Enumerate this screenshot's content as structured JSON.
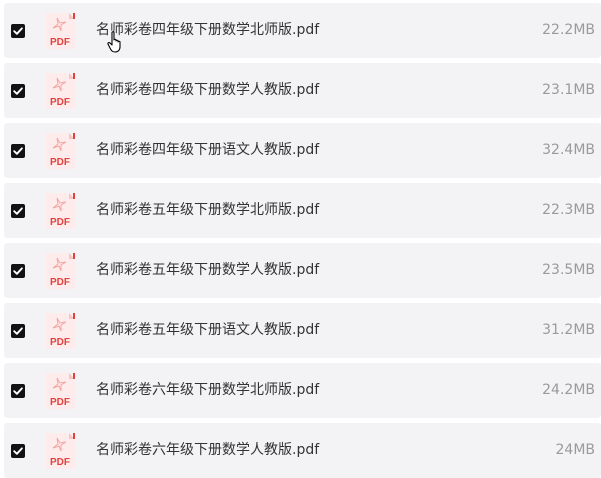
{
  "files": [
    {
      "name": "名师彩卷四年级下册数学北师版.pdf",
      "size": "22.2MB",
      "checked": true,
      "icon": "pdf-icon",
      "icon_label": "PDF"
    },
    {
      "name": "名师彩卷四年级下册数学人教版.pdf",
      "size": "23.1MB",
      "checked": true,
      "icon": "pdf-icon",
      "icon_label": "PDF"
    },
    {
      "name": "名师彩卷四年级下册语文人教版.pdf",
      "size": "32.4MB",
      "checked": true,
      "icon": "pdf-icon",
      "icon_label": "PDF"
    },
    {
      "name": "名师彩卷五年级下册数学北师版.pdf",
      "size": "22.3MB",
      "checked": true,
      "icon": "pdf-icon",
      "icon_label": "PDF"
    },
    {
      "name": "名师彩卷五年级下册数学人教版.pdf",
      "size": "23.5MB",
      "checked": true,
      "icon": "pdf-icon",
      "icon_label": "PDF"
    },
    {
      "name": "名师彩卷五年级下册语文人教版.pdf",
      "size": "31.2MB",
      "checked": true,
      "icon": "pdf-icon",
      "icon_label": "PDF"
    },
    {
      "name": "名师彩卷六年级下册数学北师版.pdf",
      "size": "24.2MB",
      "checked": true,
      "icon": "pdf-icon",
      "icon_label": "PDF"
    },
    {
      "name": "名师彩卷六年级下册数学人教版.pdf",
      "size": "24MB",
      "checked": true,
      "icon": "pdf-icon",
      "icon_label": "PDF"
    }
  ],
  "colors": {
    "row_background": "#f3f3f5",
    "checkbox": "#121212",
    "pdf_red": "#e2413e",
    "pdf_bg": "#fdeceb",
    "size_text": "#9a9a9a"
  }
}
